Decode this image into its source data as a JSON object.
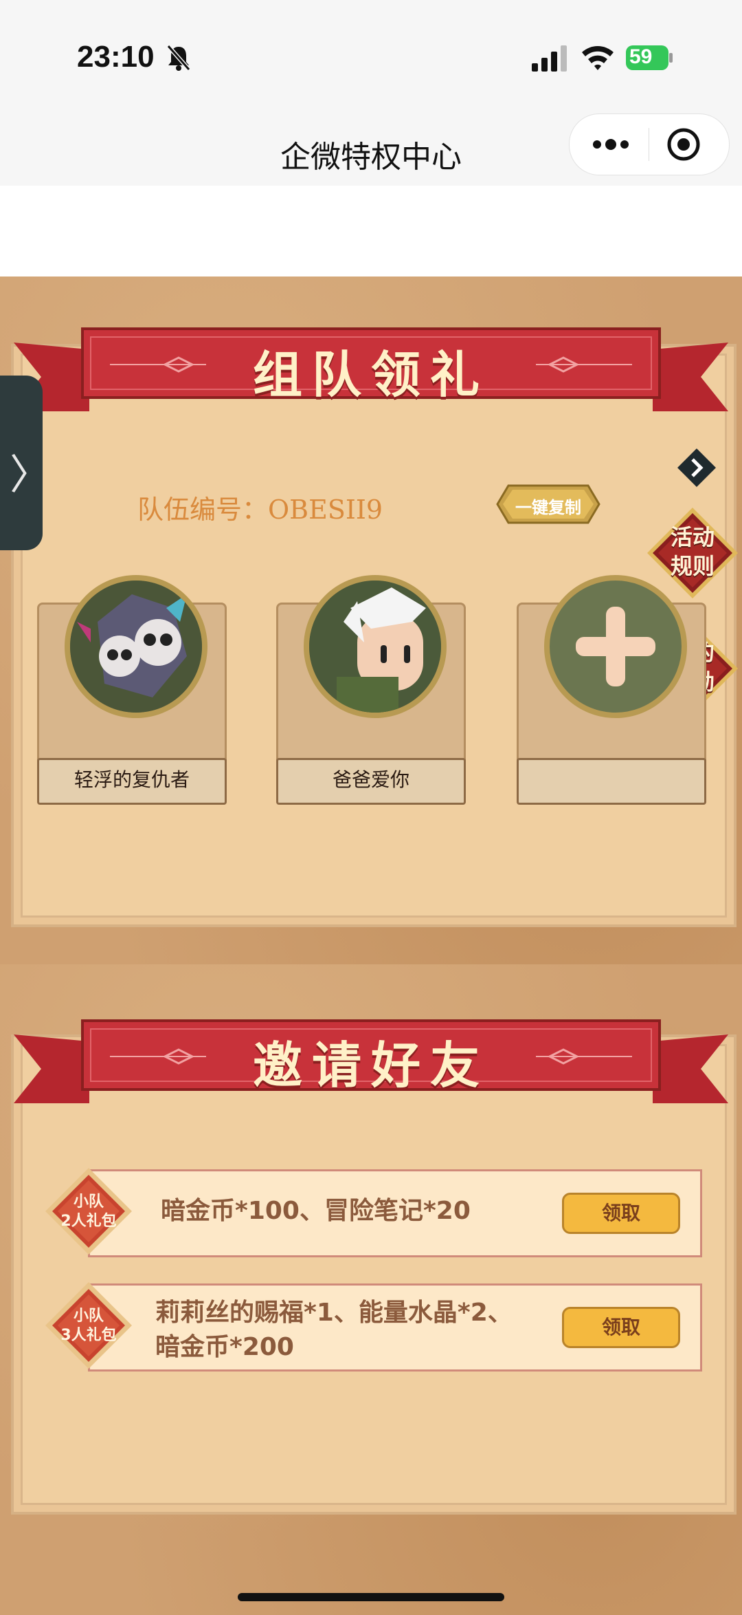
{
  "status_bar": {
    "time": "23:10",
    "battery": "59"
  },
  "nav": {
    "title": "企微特权中心"
  },
  "team_section": {
    "title": "组队领礼",
    "team_id_label": "队伍编号：OBESII9",
    "copy_button": "一键复制",
    "rules_button": [
      "活动",
      "规则"
    ],
    "rewards_button": [
      "我的",
      "奖励"
    ],
    "members": [
      {
        "name": "轻浮的复仇者"
      },
      {
        "name": "爸爸爱你"
      },
      {
        "name": ""
      }
    ]
  },
  "invite_section": {
    "title": "邀请好友",
    "gifts": [
      {
        "badge_line1": "小队",
        "badge_line2": "2人礼包",
        "text_line1": "暗金币*100、冒险笔记*20",
        "text_line2": "",
        "claim": "领取"
      },
      {
        "badge_line1": "小队",
        "badge_line2": "3人礼包",
        "text_line1": "莉莉丝的赐福*1、能量水晶*2、",
        "text_line2": "暗金币*200",
        "claim": "领取"
      }
    ]
  },
  "colors": {
    "ribbon_red": "#c8323a",
    "claim_gold": "#f4b93f",
    "parchment": "#f0cfa0"
  }
}
